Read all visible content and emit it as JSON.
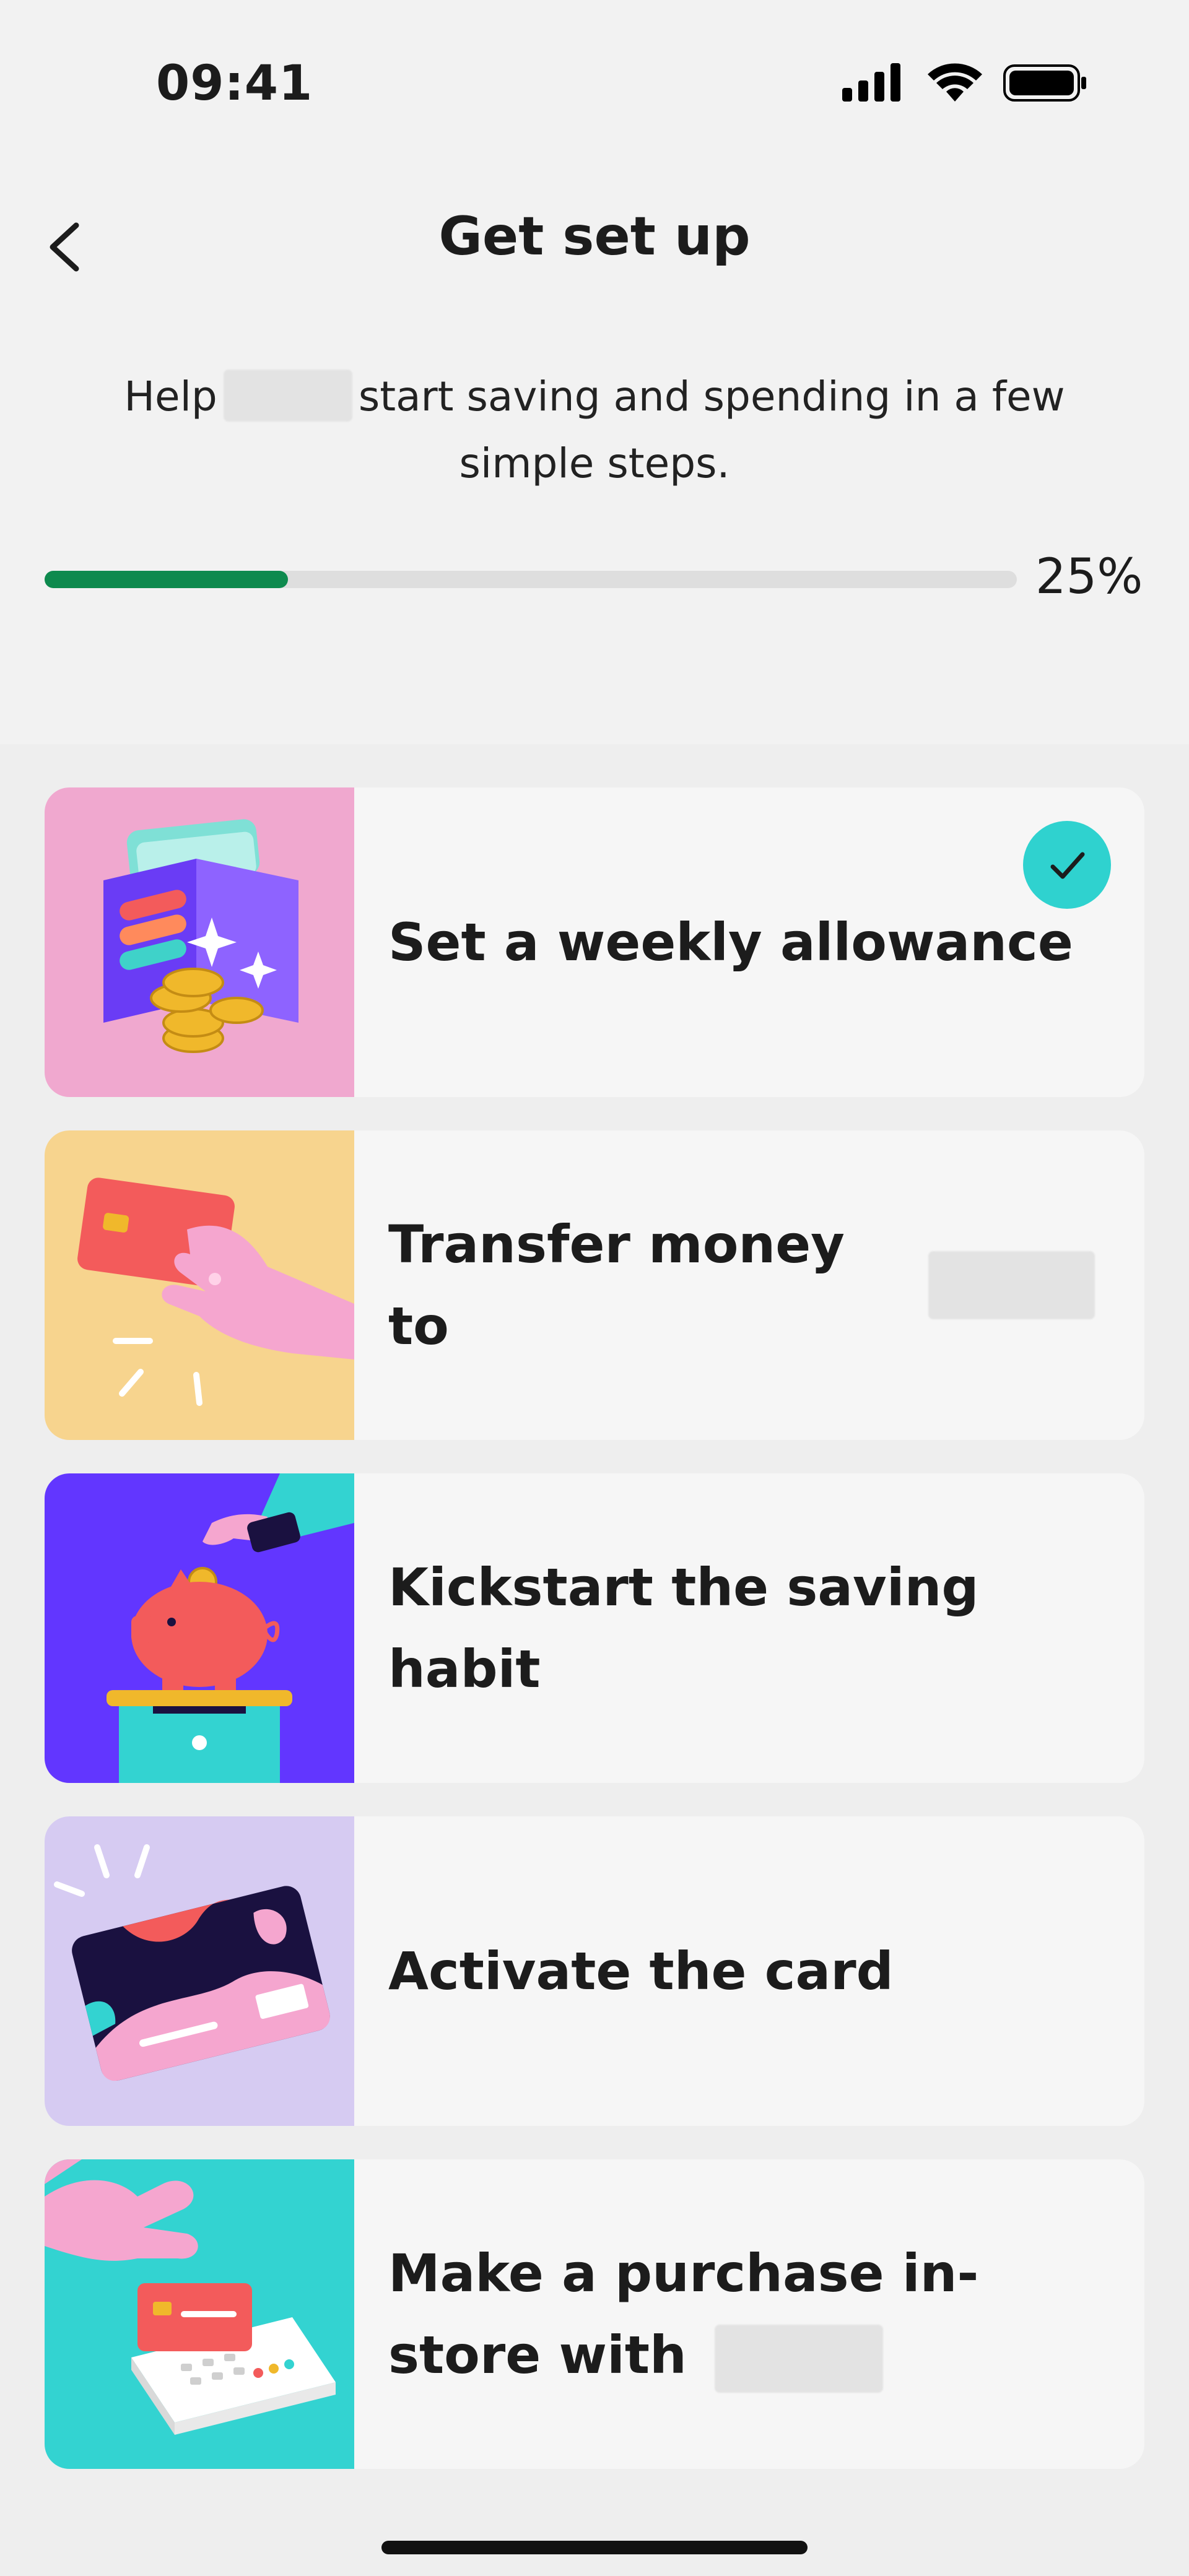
{
  "status_bar": {
    "time": "09:41"
  },
  "header": {
    "title": "Get set up",
    "intro_before": "Help",
    "intro_after": "start saving and spending in a few simple steps.",
    "progress_percent": 25,
    "progress_label": "25%"
  },
  "tasks": [
    {
      "label": "Set a weekly allowance",
      "completed": true,
      "art_color": "#f0a8cf",
      "icon": "wallet-coins-illustration"
    },
    {
      "label": "Transfer money to",
      "completed": false,
      "art_color": "#f7d48e",
      "icon": "hand-card-illustration"
    },
    {
      "label": "Kickstart the saving habit",
      "completed": false,
      "art_color": "#6236ff",
      "icon": "piggy-bank-illustration"
    },
    {
      "label": "Activate the card",
      "completed": false,
      "art_color": "#d6cbf2",
      "icon": "card-illustration"
    },
    {
      "label": "Make a purchase in-store with",
      "completed": false,
      "art_color": "#33d3d1",
      "icon": "card-terminal-illustration"
    }
  ],
  "colors": {
    "accent_green": "#0e8a4e",
    "check_teal": "#2fd2cf",
    "background": "#eeeeee"
  }
}
